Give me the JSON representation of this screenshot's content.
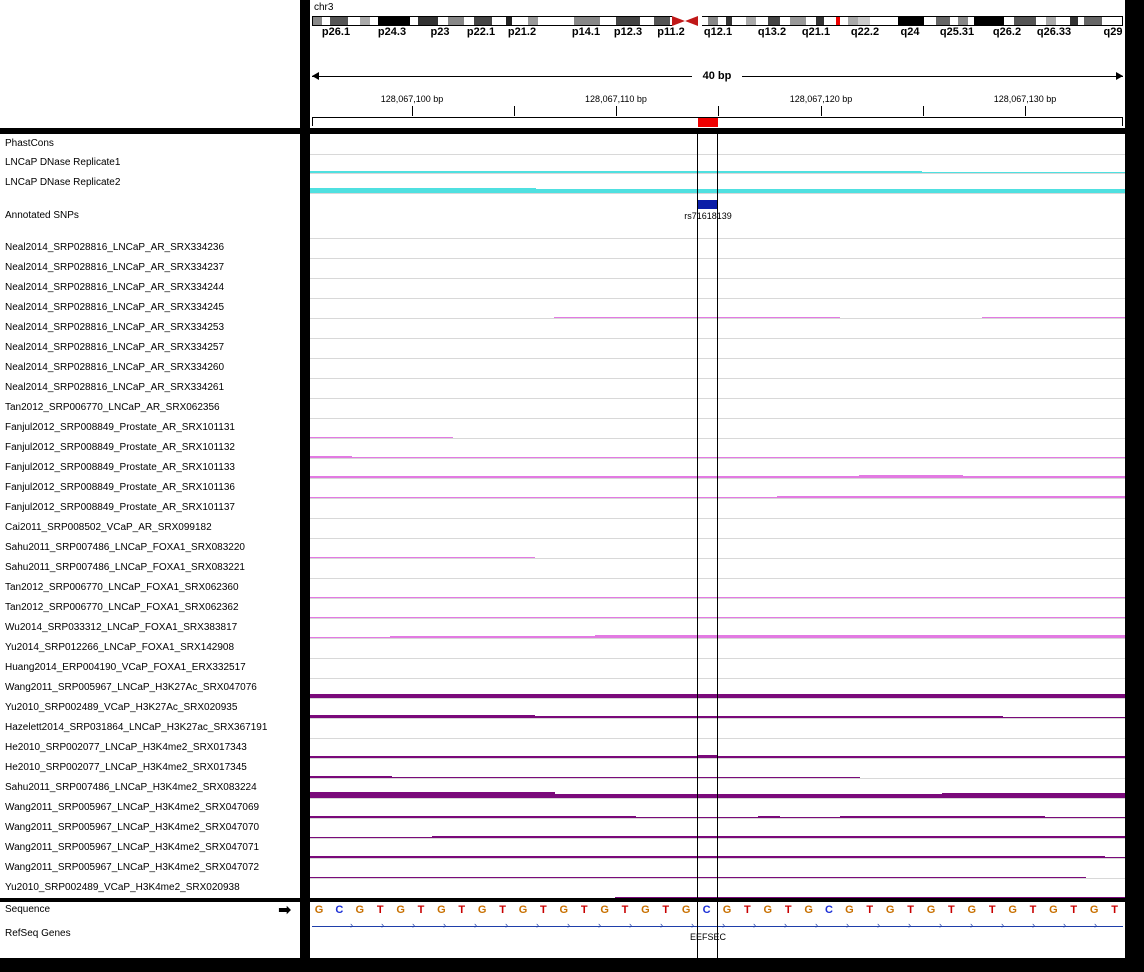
{
  "header": {
    "chromosome": "chr3",
    "span_label": "40 bp",
    "band_labels": [
      "p26.1",
      "p24.3",
      "p23",
      "p22.1",
      "p21.2",
      "p14.1",
      "p12.3",
      "p11.2",
      "q12.1",
      "q13.2",
      "q21.1",
      "q22.2",
      "q24",
      "q25.31",
      "q26.2",
      "q26.33",
      "q29"
    ],
    "ruler_labels": [
      "128,067,100 bp",
      "128,067,110 bp",
      "128,067,120 bp",
      "128,067,130 bp"
    ]
  },
  "tracks": [
    {
      "name": "PhastCons"
    },
    {
      "name": "LNCaP DNase Replicate1"
    },
    {
      "name": "LNCaP DNase Replicate2"
    },
    {
      "name": "Annotated SNPs",
      "feature_label": "rs71618139"
    },
    {
      "name": "Neal2014_SRP028816_LNCaP_AR_SRX334236"
    },
    {
      "name": "Neal2014_SRP028816_LNCaP_AR_SRX334237"
    },
    {
      "name": "Neal2014_SRP028816_LNCaP_AR_SRX334244"
    },
    {
      "name": "Neal2014_SRP028816_LNCaP_AR_SRX334245"
    },
    {
      "name": "Neal2014_SRP028816_LNCaP_AR_SRX334253"
    },
    {
      "name": "Neal2014_SRP028816_LNCaP_AR_SRX334257"
    },
    {
      "name": "Neal2014_SRP028816_LNCaP_AR_SRX334260"
    },
    {
      "name": "Neal2014_SRP028816_LNCaP_AR_SRX334261"
    },
    {
      "name": "Tan2012_SRP006770_LNCaP_AR_SRX062356"
    },
    {
      "name": "Fanjul2012_SRP008849_Prostate_AR_SRX101131"
    },
    {
      "name": "Fanjul2012_SRP008849_Prostate_AR_SRX101132"
    },
    {
      "name": "Fanjul2012_SRP008849_Prostate_AR_SRX101133"
    },
    {
      "name": "Fanjul2012_SRP008849_Prostate_AR_SRX101136"
    },
    {
      "name": "Fanjul2012_SRP008849_Prostate_AR_SRX101137"
    },
    {
      "name": "Cai2011_SRP008502_VCaP_AR_SRX099182"
    },
    {
      "name": "Sahu2011_SRP007486_LNCaP_FOXA1_SRX083220"
    },
    {
      "name": "Sahu2011_SRP007486_LNCaP_FOXA1_SRX083221"
    },
    {
      "name": "Tan2012_SRP006770_LNCaP_FOXA1_SRX062360"
    },
    {
      "name": "Tan2012_SRP006770_LNCaP_FOXA1_SRX062362"
    },
    {
      "name": "Wu2014_SRP033312_LNCaP_FOXA1_SRX383817"
    },
    {
      "name": "Yu2014_SRP012266_LNCaP_FOXA1_SRX142908"
    },
    {
      "name": "Huang2014_ERP004190_VCaP_FOXA1_ERX332517"
    },
    {
      "name": "Wang2011_SRP005967_LNCaP_H3K27Ac_SRX047076"
    },
    {
      "name": "Yu2010_SRP002489_VCaP_H3K27Ac_SRX020935"
    },
    {
      "name": "Hazelett2014_SRP031864_LNCaP_H3K27ac_SRX367191"
    },
    {
      "name": "He2010_SRP002077_LNCaP_H3K4me2_SRX017343"
    },
    {
      "name": "He2010_SRP002077_LNCaP_H3K4me2_SRX017345"
    },
    {
      "name": "Sahu2011_SRP007486_LNCaP_H3K4me2_SRX083224"
    },
    {
      "name": "Wang2011_SRP005967_LNCaP_H3K4me2_SRX047069"
    },
    {
      "name": "Wang2011_SRP005967_LNCaP_H3K4me2_SRX047070"
    },
    {
      "name": "Wang2011_SRP005967_LNCaP_H3K4me2_SRX047071"
    },
    {
      "name": "Wang2011_SRP005967_LNCaP_H3K4me2_SRX047072"
    },
    {
      "name": "Yu2010_SRP002489_VCaP_H3K4me2_SRX020938"
    }
  ],
  "bottom": {
    "sequence_label": "Sequence",
    "sequence_arrow_icon": "right-arrow-icon",
    "sequence": "GCGTGTGTGTGTGTGTGTGCGTGTGCGTGTGTGTGTGTGT",
    "refseq_label": "RefSeq Genes",
    "gene_name": "EEFSEC"
  },
  "colors": {
    "dnase": "#4fe0e0",
    "ar_foxa1": "#e27ae2",
    "histone": "#7a0a7a",
    "snp": "#0b1ea8",
    "base_G": "#c87000",
    "base_C": "#1b2fd6",
    "base_T": "#c80000",
    "centromere": "#c01818",
    "locus_marker": "#ee0000"
  }
}
